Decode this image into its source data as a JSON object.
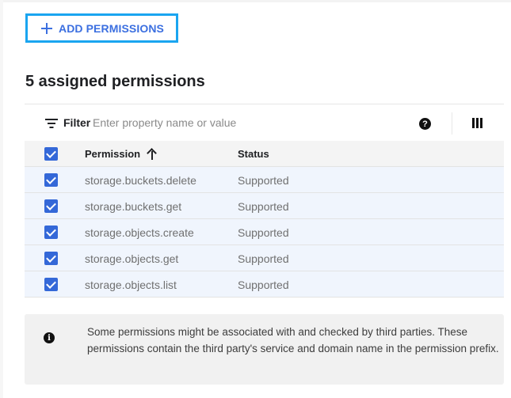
{
  "toolbar": {
    "add_button_label": "ADD PERMISSIONS",
    "add_icon": "plus-icon"
  },
  "section": {
    "title": "5 assigned permissions"
  },
  "filter": {
    "icon": "filter-icon",
    "label": "Filter",
    "placeholder": "Enter property name or value",
    "value": "",
    "help_icon": "help-icon",
    "help_glyph": "?",
    "columns_icon": "column-display-icon"
  },
  "table": {
    "columns": [
      {
        "label": "Permission",
        "sorted": "ascending"
      },
      {
        "label": "Status"
      }
    ],
    "select_all_checked": true,
    "rows": [
      {
        "checked": true,
        "permission": "storage.buckets.delete",
        "status": "Supported"
      },
      {
        "checked": true,
        "permission": "storage.buckets.get",
        "status": "Supported"
      },
      {
        "checked": true,
        "permission": "storage.objects.create",
        "status": "Supported"
      },
      {
        "checked": true,
        "permission": "storage.objects.get",
        "status": "Supported"
      },
      {
        "checked": true,
        "permission": "storage.objects.list",
        "status": "Supported"
      }
    ]
  },
  "info": {
    "icon": "info-icon",
    "glyph": "i",
    "text": "Some permissions might be associated with and checked by third parties. These permissions contain the third party's service and domain name in the permission prefix."
  },
  "colors": {
    "accent": "#3b6fe0",
    "focus_ring": "#1aa5f0",
    "checkbox": "#3468d8",
    "selected_row": "#f0f5fd",
    "header_row": "#f4f4f4",
    "info_bg": "#f1f1f1"
  }
}
